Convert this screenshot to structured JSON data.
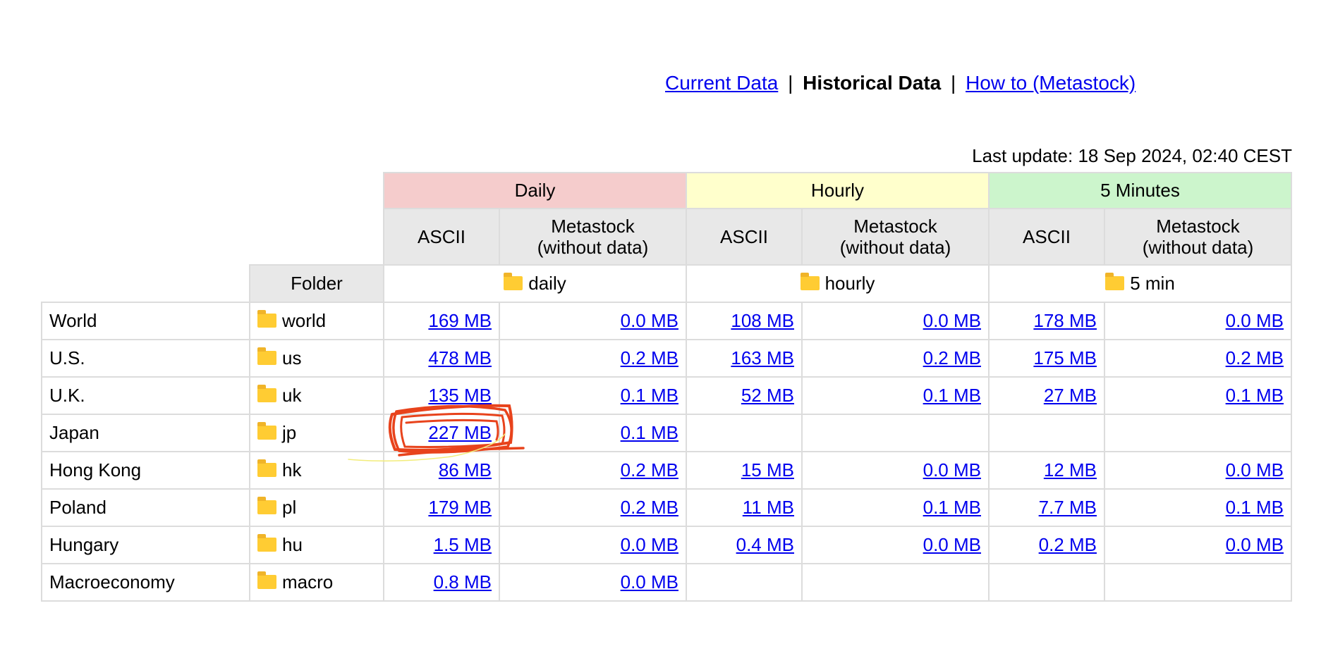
{
  "nav": {
    "current_data": "Current Data",
    "separator": "|",
    "historical_data": "Historical Data",
    "how_to": "How to (Metastock)"
  },
  "last_update": "Last update: 18 Sep 2024, 02:40 CEST",
  "header": {
    "daily": "Daily",
    "hourly": "Hourly",
    "five_min": "5 Minutes",
    "ascii": "ASCII",
    "metastock_line1": "Metastock",
    "metastock_line2": "(without data)",
    "folder": "Folder",
    "folder_daily": "daily",
    "folder_hourly": "hourly",
    "folder_5min": "5 min"
  },
  "rows": [
    {
      "region": "World",
      "folder": "world",
      "d_ascii": "169 MB",
      "d_meta": "0.0 MB",
      "h_ascii": "108 MB",
      "h_meta": "0.0 MB",
      "m_ascii": "178 MB",
      "m_meta": "0.0 MB"
    },
    {
      "region": "U.S.",
      "folder": "us",
      "d_ascii": "478 MB",
      "d_meta": "0.2 MB",
      "h_ascii": "163 MB",
      "h_meta": "0.2 MB",
      "m_ascii": "175 MB",
      "m_meta": "0.2 MB"
    },
    {
      "region": "U.K.",
      "folder": "uk",
      "d_ascii": "135 MB",
      "d_meta": "0.1 MB",
      "h_ascii": "52 MB",
      "h_meta": "0.1 MB",
      "m_ascii": "27 MB",
      "m_meta": "0.1 MB"
    },
    {
      "region": "Japan",
      "folder": "jp",
      "d_ascii": "227 MB",
      "d_meta": "0.1 MB",
      "h_ascii": "",
      "h_meta": "",
      "m_ascii": "",
      "m_meta": ""
    },
    {
      "region": "Hong Kong",
      "folder": "hk",
      "d_ascii": "86 MB",
      "d_meta": "0.2 MB",
      "h_ascii": "15 MB",
      "h_meta": "0.0 MB",
      "m_ascii": "12 MB",
      "m_meta": "0.0 MB"
    },
    {
      "region": "Poland",
      "folder": "pl",
      "d_ascii": "179 MB",
      "d_meta": "0.2 MB",
      "h_ascii": "11 MB",
      "h_meta": "0.1 MB",
      "m_ascii": "7.7 MB",
      "m_meta": "0.1 MB"
    },
    {
      "region": "Hungary",
      "folder": "hu",
      "d_ascii": "1.5 MB",
      "d_meta": "0.0 MB",
      "h_ascii": "0.4 MB",
      "h_meta": "0.0 MB",
      "m_ascii": "0.2 MB",
      "m_meta": "0.0 MB"
    },
    {
      "region": "Macroeconomy",
      "folder": "macro",
      "d_ascii": "0.8 MB",
      "d_meta": "0.0 MB",
      "h_ascii": "",
      "h_meta": "",
      "m_ascii": "",
      "m_meta": ""
    }
  ],
  "colors": {
    "daily_bg": "#f5cccc",
    "hourly_bg": "#ffffcc",
    "five_min_bg": "#ccf5cc",
    "subheader_bg": "#e8e8e8",
    "link": "#0000ee",
    "annotation": "#e8431c"
  },
  "icons": {
    "folder": "folder-icon"
  }
}
